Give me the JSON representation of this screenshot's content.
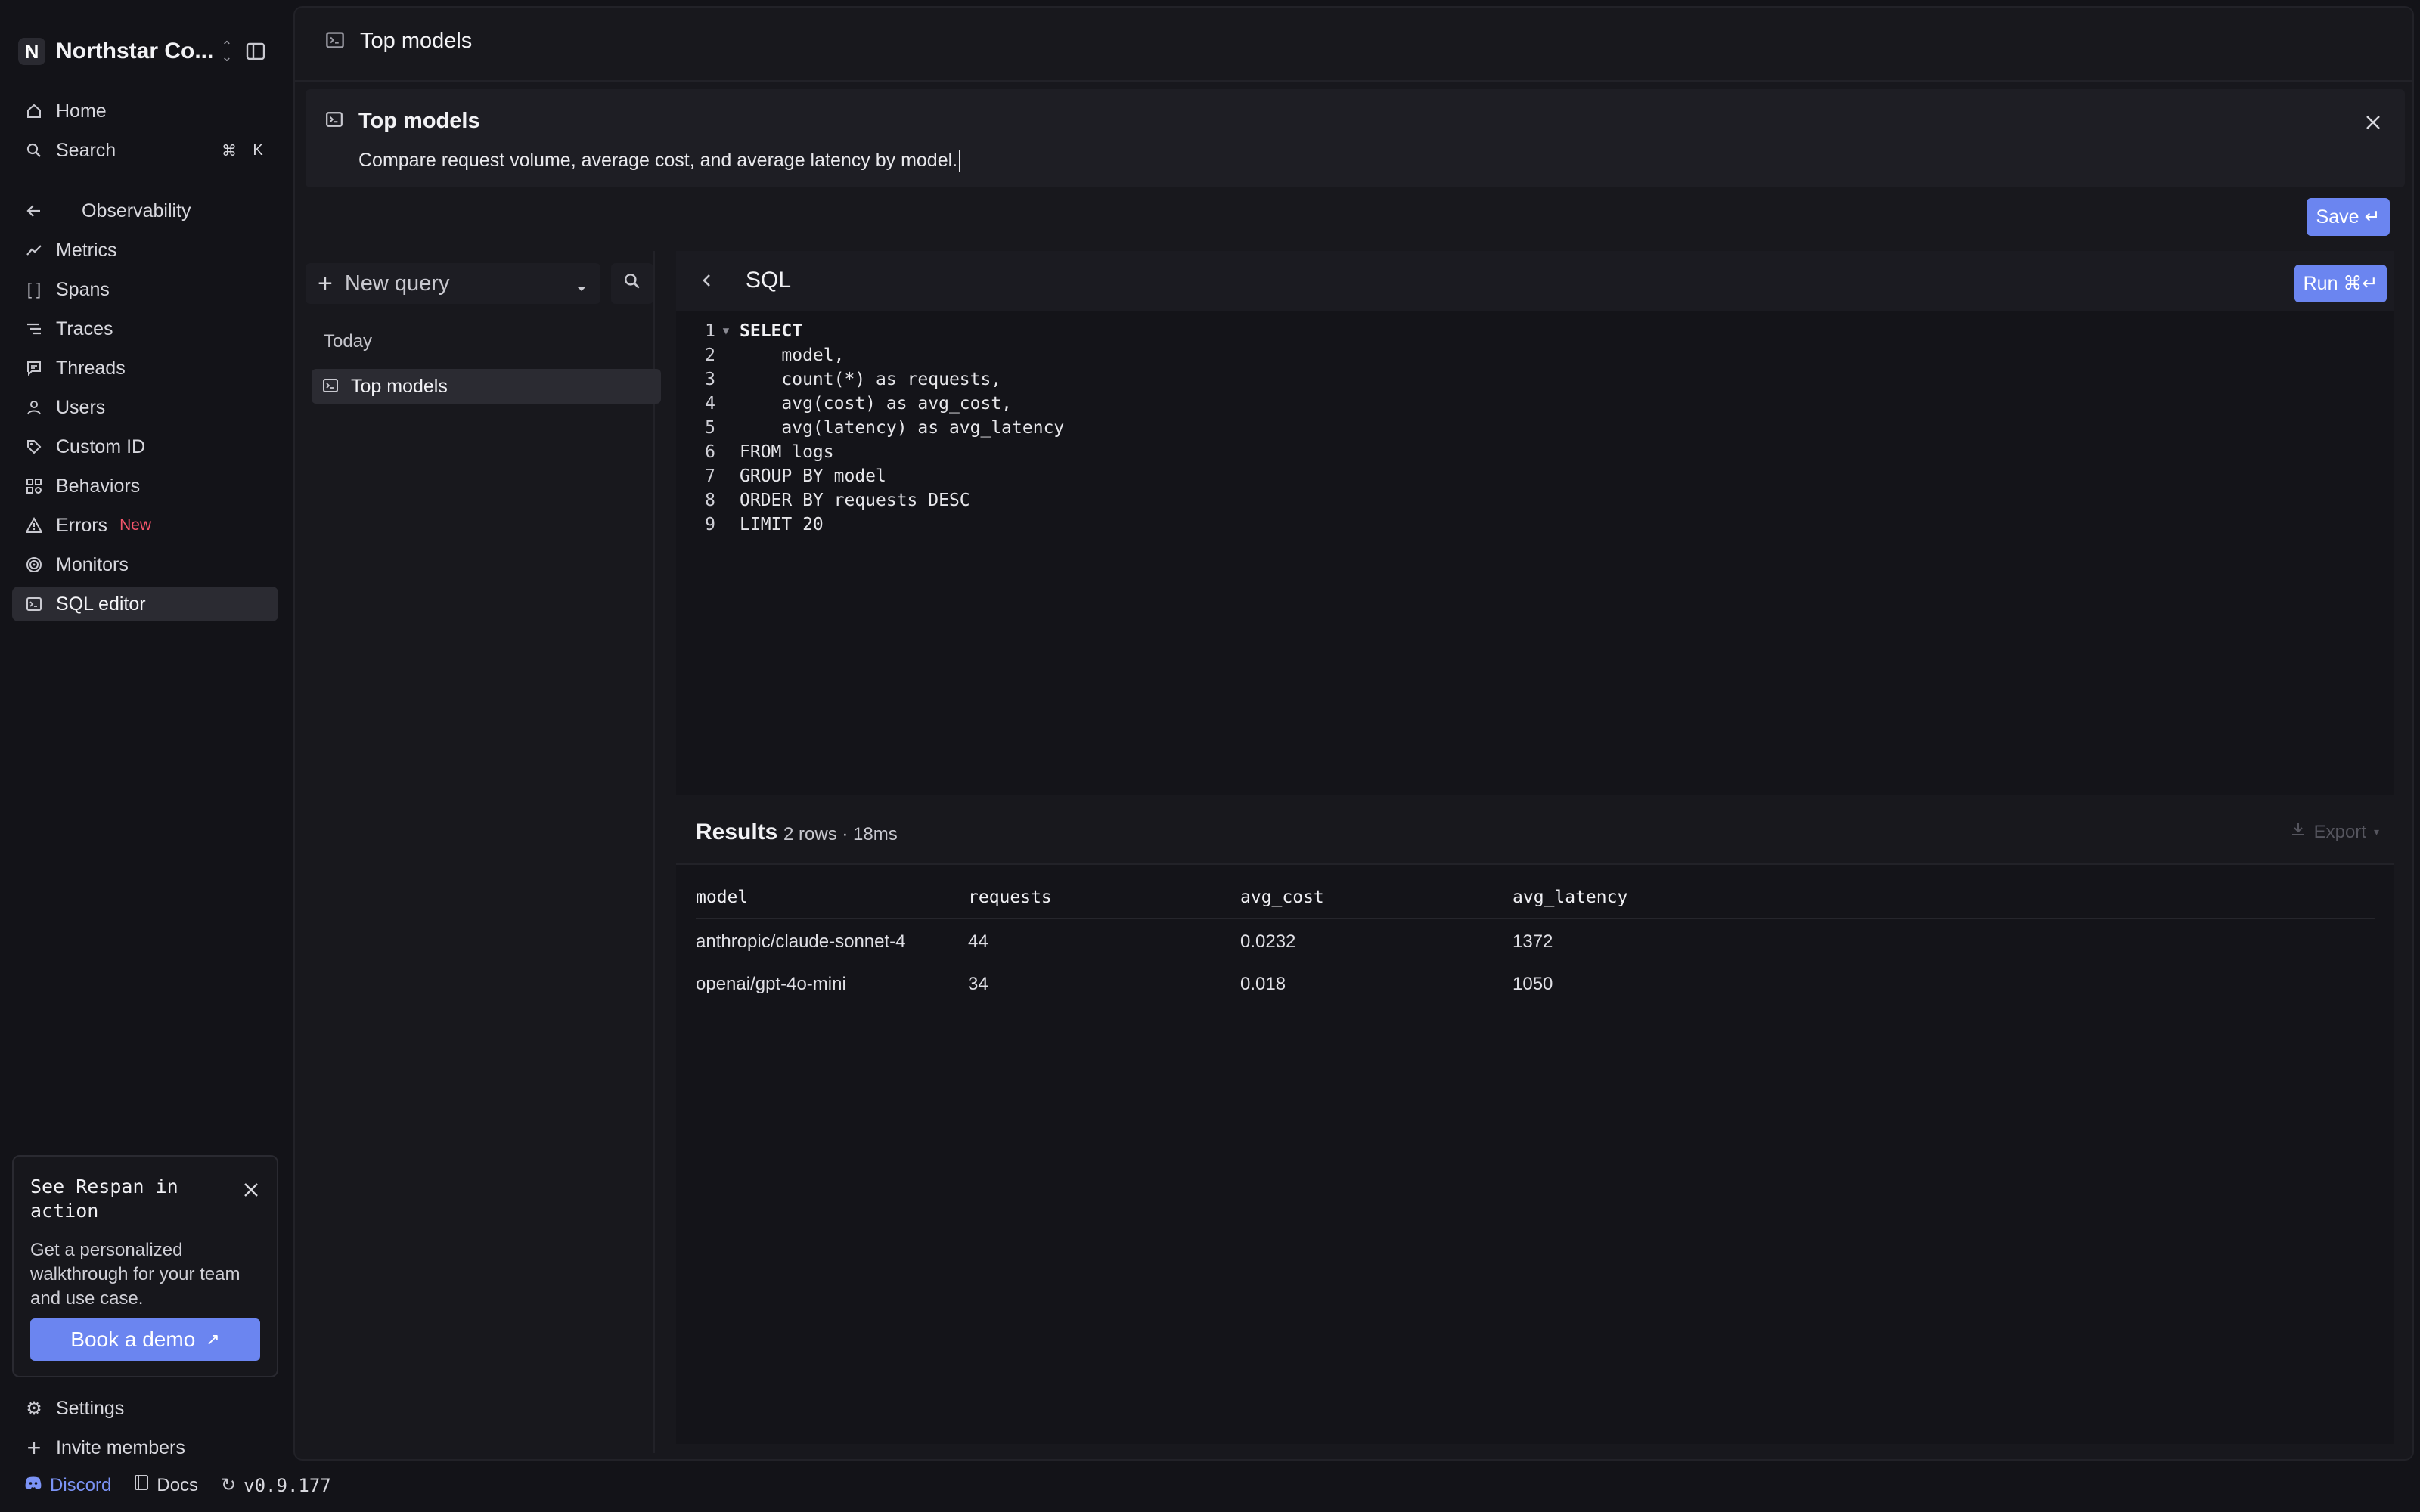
{
  "workspace": {
    "initial": "N",
    "name": "Northstar Co..."
  },
  "sidebar": {
    "home": "Home",
    "search": "Search",
    "search_shortcut": [
      "⌘",
      "K"
    ],
    "section": "Observability",
    "items": [
      {
        "label": "Metrics",
        "icon": "line-chart-icon"
      },
      {
        "label": "Spans",
        "icon": "brackets-icon"
      },
      {
        "label": "Traces",
        "icon": "list-tree-icon"
      },
      {
        "label": "Threads",
        "icon": "message-icon"
      },
      {
        "label": "Users",
        "icon": "user-icon"
      },
      {
        "label": "Custom ID",
        "icon": "tag-icon"
      },
      {
        "label": "Behaviors",
        "icon": "grid-icon"
      },
      {
        "label": "Errors",
        "icon": "alert-icon",
        "badge": "New"
      },
      {
        "label": "Monitors",
        "icon": "radar-icon"
      },
      {
        "label": "SQL editor",
        "icon": "terminal-icon",
        "active": true
      }
    ],
    "settings": "Settings",
    "invite": "Invite members"
  },
  "demo_card": {
    "title": "See Respan in action",
    "body": "Get a personalized walkthrough for your team and use case.",
    "button": "Book a demo"
  },
  "footer": {
    "discord": "Discord",
    "docs": "Docs",
    "version": "v0.9.177"
  },
  "topbar": {
    "title": "Top models"
  },
  "description_card": {
    "title": "Top models",
    "text": "Compare request volume, average cost, and average latency by model."
  },
  "save_button": "Save ↵",
  "query_list": {
    "new_query": "New query",
    "group": "Today",
    "items": [
      "Top models"
    ]
  },
  "editor": {
    "title": "SQL",
    "run_button": "Run ⌘↵",
    "lines": [
      "SELECT",
      "    model,",
      "    count(*) as requests,",
      "    avg(cost) as avg_cost,",
      "    avg(latency) as avg_latency",
      "FROM logs",
      "GROUP BY model",
      "ORDER BY requests DESC",
      "LIMIT 20"
    ]
  },
  "results": {
    "title": "Results",
    "meta": "2 rows · 18ms",
    "export": "Export",
    "columns": [
      "model",
      "requests",
      "avg_cost",
      "avg_latency"
    ],
    "rows": [
      [
        "anthropic/claude-sonnet-4",
        "44",
        "0.0232",
        "1372"
      ],
      [
        "openai/gpt-4o-mini",
        "34",
        "0.018",
        "1050"
      ]
    ]
  },
  "colors": {
    "accent": "#6b85f0",
    "badge_new": "#f5556b",
    "background": "#131318"
  }
}
